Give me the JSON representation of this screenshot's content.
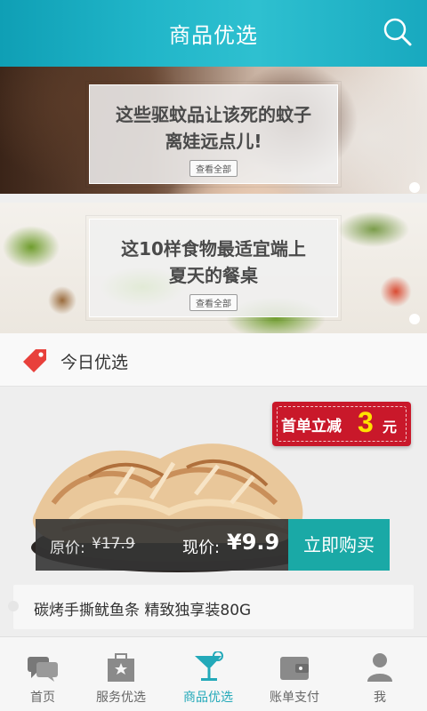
{
  "header": {
    "title": "商品优选",
    "search_icon": "search-icon"
  },
  "banners": [
    {
      "headline_line1": "这些驱蚊品让该死的蚊子",
      "headline_line2": "离娃远点儿!",
      "button_label": "查看全部"
    },
    {
      "headline_line1": "这10样食物最适宜端上",
      "headline_line2": "夏天的餐桌",
      "button_label": "查看全部"
    }
  ],
  "section": {
    "title": "今日优选",
    "icon": "tag-icon",
    "icon_color": "#e8403b"
  },
  "product": {
    "badge": {
      "text": "首单立减",
      "amount": "3",
      "unit": "元",
      "color": "#c9182a"
    },
    "original_price_label": "原价:",
    "original_price_symbol": "¥",
    "original_price_value": "17.9",
    "current_price_label": "现价:",
    "current_price": "¥9.9",
    "buy_label": "立即购买",
    "buy_color": "#1aa9a6",
    "name": "碳烤手撕鱿鱼条  精致独享装80G"
  },
  "nav": {
    "active_color": "#23a9b9",
    "items": [
      {
        "label": "首页",
        "icon": "chat-icon"
      },
      {
        "label": "服务优选",
        "icon": "service-icon"
      },
      {
        "label": "商品优选",
        "icon": "cocktail-icon"
      },
      {
        "label": "账单支付",
        "icon": "wallet-icon"
      },
      {
        "label": "我",
        "icon": "user-icon"
      }
    ]
  }
}
